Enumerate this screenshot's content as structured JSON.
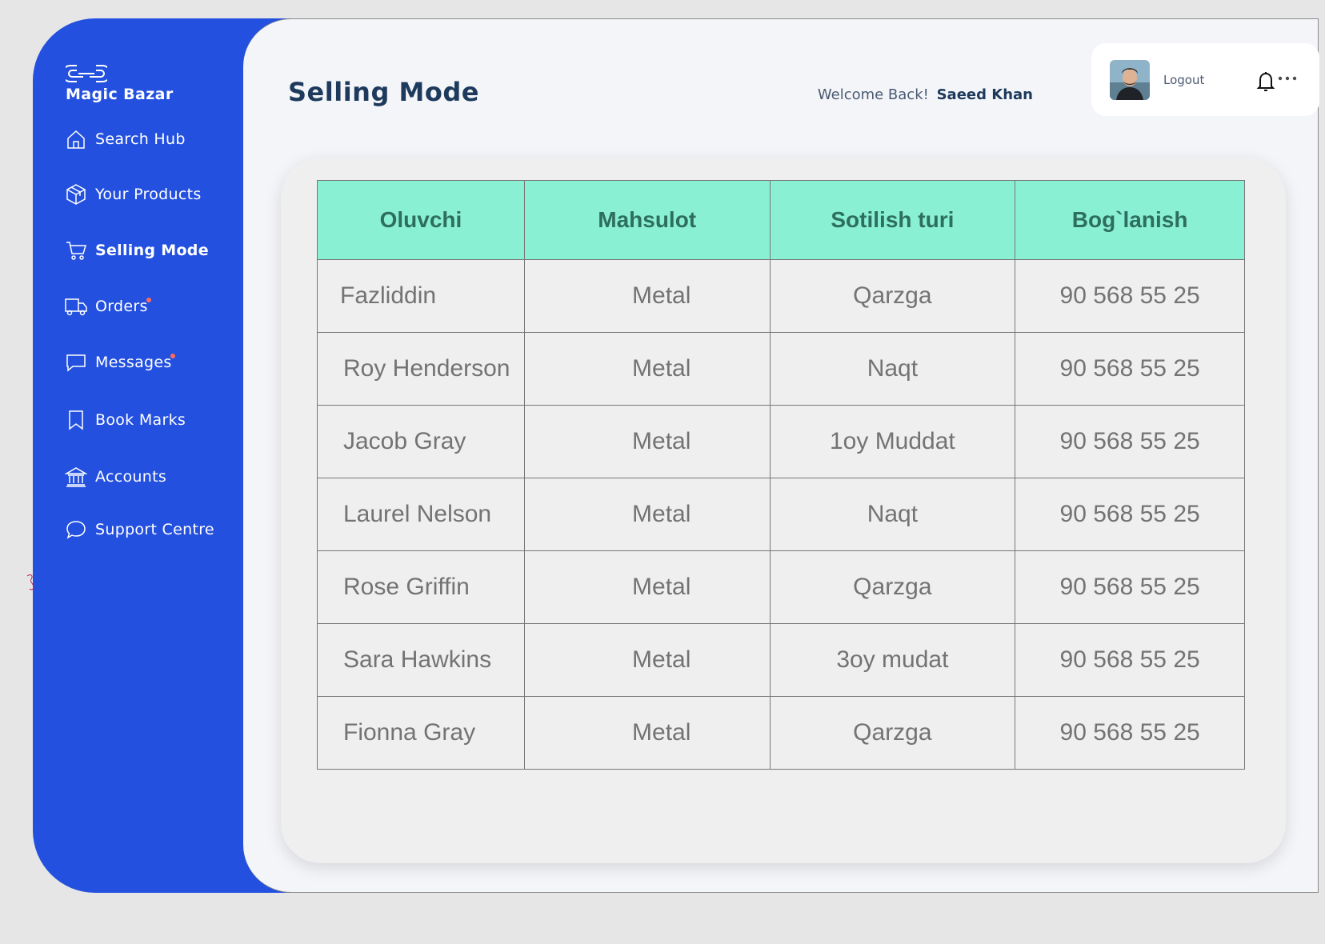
{
  "app": {
    "name": "Magic Bazar"
  },
  "sidebar": {
    "items": [
      {
        "label": "Search Hub",
        "icon": "home-icon",
        "active": false,
        "badge": false
      },
      {
        "label": "Your Products",
        "icon": "package-icon",
        "active": false,
        "badge": false
      },
      {
        "label": "Selling Mode",
        "icon": "cart-icon",
        "active": true,
        "badge": false
      },
      {
        "label": "Orders",
        "icon": "truck-icon",
        "active": false,
        "badge": true
      },
      {
        "label": "Messages",
        "icon": "message-icon",
        "active": false,
        "badge": true
      },
      {
        "label": "Book Marks",
        "icon": "bookmark-icon",
        "active": false,
        "badge": false
      },
      {
        "label": "Accounts",
        "icon": "bank-icon",
        "active": false,
        "badge": false
      },
      {
        "label": "Support Centre",
        "icon": "chat-bubble-icon",
        "active": false,
        "badge": false
      }
    ]
  },
  "header": {
    "title": "Selling Mode",
    "welcome_text": "Welcome Back!",
    "user_name": "Saeed Khan",
    "logout_label": "Logout"
  },
  "table": {
    "columns": [
      "Oluvchi",
      "Mahsulot",
      "Sotilish turi",
      "Bog`lanish"
    ],
    "rows": [
      [
        "Fazliddin",
        "Metal",
        "Qarzga",
        "90 568 55 25"
      ],
      [
        "Roy Henderson",
        "Metal",
        "Naqt",
        "90 568 55 25"
      ],
      [
        "Jacob Gray",
        "Metal",
        "1oy Muddat",
        "90 568 55 25"
      ],
      [
        "Laurel Nelson",
        "Metal",
        "Naqt",
        "90 568 55 25"
      ],
      [
        "Rose Griffin",
        "Metal",
        "Qarzga",
        "90 568 55 25"
      ],
      [
        "Sara Hawkins",
        "Metal",
        "3oy mudat",
        "90 568 55 25"
      ],
      [
        "Fionna Gray",
        "Metal",
        "Qarzga",
        "90 568 55 25"
      ]
    ]
  },
  "colors": {
    "sidebar_bg": "#2350df",
    "table_header_bg": "#8af0d4",
    "title_color": "#1d3a5c",
    "badge_color": "#ff6b5a"
  }
}
